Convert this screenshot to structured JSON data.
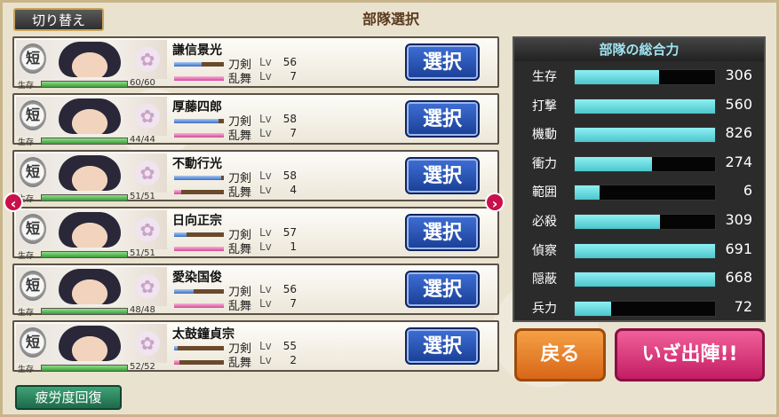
{
  "header": {
    "switch_label": "切り替え",
    "title": "部隊選択"
  },
  "units": [
    {
      "type": "短",
      "name": "謙信景光",
      "hp_label": "生存",
      "hp": "60/60",
      "hp_fraction": 1.0,
      "sword_label": "刀剣",
      "sword_lv": "56",
      "sword_xp": 0.55,
      "dance_label": "乱舞",
      "dance_lv": "7",
      "dance_xp": 1.0,
      "lv_tag": "Lv",
      "select_label": "選択"
    },
    {
      "type": "短",
      "name": "厚藤四郎",
      "hp_label": "生存",
      "hp": "44/44",
      "hp_fraction": 1.0,
      "sword_label": "刀剣",
      "sword_lv": "58",
      "sword_xp": 0.9,
      "dance_label": "乱舞",
      "dance_lv": "7",
      "dance_xp": 1.0,
      "lv_tag": "Lv",
      "select_label": "選択"
    },
    {
      "type": "短",
      "name": "不動行光",
      "hp_label": "生存",
      "hp": "51/51",
      "hp_fraction": 1.0,
      "sword_label": "刀剣",
      "sword_lv": "58",
      "sword_xp": 0.95,
      "dance_label": "乱舞",
      "dance_lv": "4",
      "dance_xp": 0.15,
      "lv_tag": "Lv",
      "select_label": "選択"
    },
    {
      "type": "短",
      "name": "日向正宗",
      "hp_label": "生存",
      "hp": "51/51",
      "hp_fraction": 1.0,
      "sword_label": "刀剣",
      "sword_lv": "57",
      "sword_xp": 0.25,
      "dance_label": "乱舞",
      "dance_lv": "1",
      "dance_xp": 1.0,
      "lv_tag": "Lv",
      "select_label": "選択"
    },
    {
      "type": "短",
      "name": "愛染国俊",
      "hp_label": "生存",
      "hp": "48/48",
      "hp_fraction": 1.0,
      "sword_label": "刀剣",
      "sword_lv": "56",
      "sword_xp": 0.4,
      "dance_label": "乱舞",
      "dance_lv": "7",
      "dance_xp": 1.0,
      "lv_tag": "Lv",
      "select_label": "選択"
    },
    {
      "type": "短",
      "name": "太鼓鐘貞宗",
      "hp_label": "生存",
      "hp": "52/52",
      "hp_fraction": 1.0,
      "sword_label": "刀剣",
      "sword_lv": "55",
      "sword_xp": 0.08,
      "dance_label": "乱舞",
      "dance_lv": "2",
      "dance_xp": 0.1,
      "lv_tag": "Lv",
      "select_label": "選択"
    }
  ],
  "nav": {
    "prev_glyph": "‹",
    "next_glyph": "›"
  },
  "recover_label": "疲労度回復",
  "stats": {
    "title": "部隊の総合力",
    "rows": [
      {
        "label": "生存",
        "value": "306",
        "fraction": 0.6
      },
      {
        "label": "打撃",
        "value": "560",
        "fraction": 1.0
      },
      {
        "label": "機動",
        "value": "826",
        "fraction": 1.0
      },
      {
        "label": "衝力",
        "value": "274",
        "fraction": 0.55
      },
      {
        "label": "範囲",
        "value": "6",
        "fraction": 0.18
      },
      {
        "label": "必殺",
        "value": "309",
        "fraction": 0.61
      },
      {
        "label": "偵察",
        "value": "691",
        "fraction": 1.0
      },
      {
        "label": "隠蔽",
        "value": "668",
        "fraction": 1.0
      },
      {
        "label": "兵力",
        "value": "72",
        "fraction": 0.26
      }
    ]
  },
  "actions": {
    "back_label": "戻る",
    "sortie_label": "いざ出陣!!"
  },
  "colors": {
    "select": "#2a55b8",
    "back": "#e5822c",
    "sortie": "#dc3b7f",
    "stat_fill": "#6fe0e6",
    "arrow": "#c8104a"
  }
}
